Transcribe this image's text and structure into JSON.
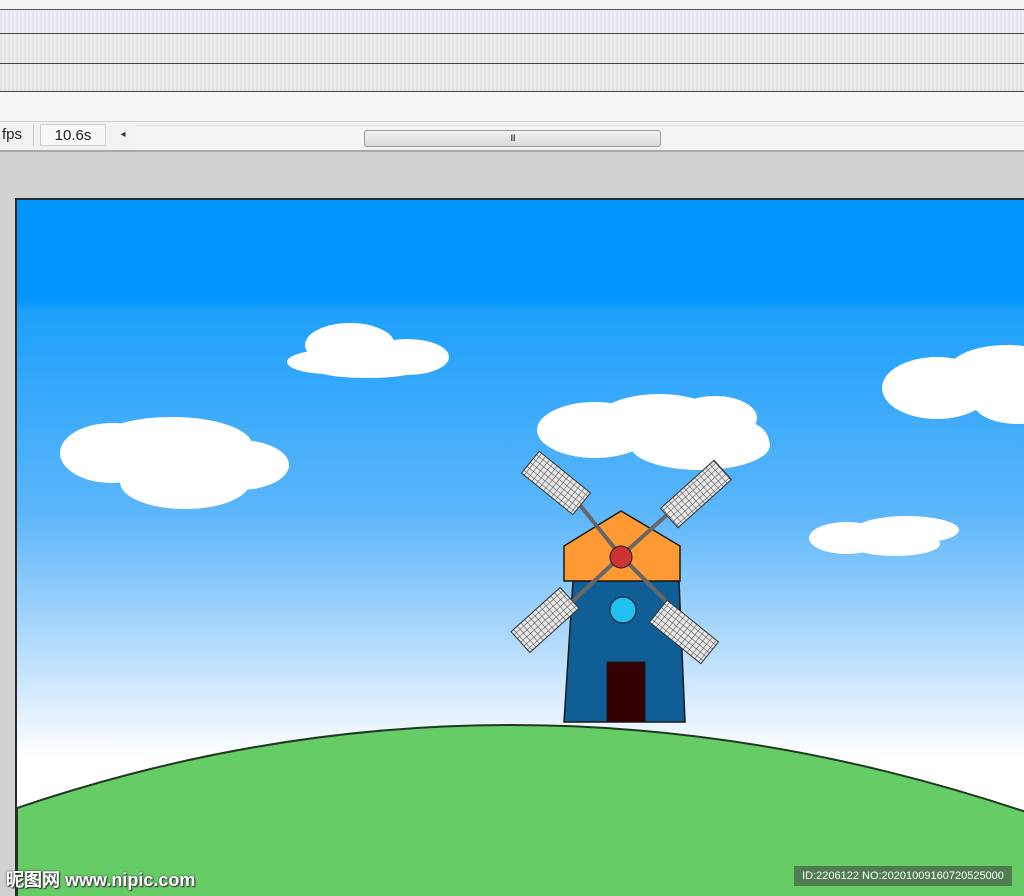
{
  "timeline": {
    "fps_label": "fps",
    "elapsed_time": "10.6s",
    "scroll_left_glyph": "◂",
    "scroll_grip_glyph": "III"
  },
  "stage": {
    "sky_top": "#0096ff",
    "sky_bottom": "#ffffff",
    "hill_color": "#66cc66",
    "windmill": {
      "tower_color": "#0f5f96",
      "roof_color": "#ff9933",
      "hub_color": "#cc3333",
      "window_color": "#22c0f0",
      "door_color": "#330000",
      "blade_fill": "#e8e8e8"
    }
  },
  "watermarks": {
    "site": "昵图网 www.nipic.com",
    "id_text": "ID:2206122 NO:20201009160720525000"
  }
}
